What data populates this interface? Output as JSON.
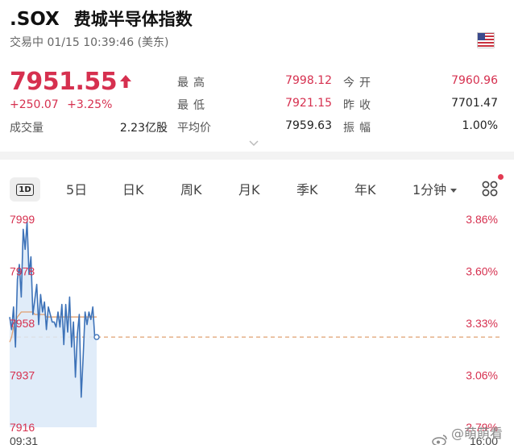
{
  "header": {
    "ticker": ".SOX",
    "name": "费城半导体指数",
    "status": "交易中 01/15 10:39:46 (美东)",
    "flag_icon": "us-flag-icon"
  },
  "quote": {
    "price": "7951.55",
    "direction": "up",
    "change": "+250.07",
    "change_pct": "+3.25%",
    "volume_label": "成交量",
    "volume_value": "2.23亿股",
    "up_color": "#d6304f"
  },
  "stats": {
    "high_label": "最高",
    "high_value": "7998.12",
    "low_label": "最低",
    "low_value": "7921.15",
    "avg_label": "平均价",
    "avg_value": "7959.63",
    "open_label": "今开",
    "open_value": "7960.96",
    "prev_close_label": "昨收",
    "prev_close_value": "7701.47",
    "amplitude_label": "振幅",
    "amplitude_value": "1.00%"
  },
  "tabs": {
    "active": "1D",
    "items": [
      "5日",
      "日K",
      "周K",
      "月K",
      "季K",
      "年K"
    ],
    "interval": "1分钟"
  },
  "chart_data": {
    "type": "line",
    "y_ticks": [
      "7999",
      "7978",
      "7958",
      "7937",
      "7916"
    ],
    "pct_ticks": [
      "3.86%",
      "3.60%",
      "3.33%",
      "3.06%",
      "2.79%"
    ],
    "ylim": [
      7916,
      7999
    ],
    "prev_close_ref": "7952",
    "x_start": "09:31",
    "x_end": "16:00",
    "price_color": "#3d72b8",
    "avg_color": "#e0a070",
    "fill_color": "#dbe9f8",
    "series": [
      {
        "values": [
          7960,
          7955,
          7964,
          7948,
          7975,
          7981,
          7968,
          7995,
          7987,
          7998,
          7977,
          7984,
          7961,
          7967,
          7973,
          7957,
          7969,
          7962,
          7966,
          7955,
          7964,
          7961,
          7958,
          7958,
          7956,
          7962,
          7956,
          7965,
          7949,
          7965,
          7954,
          7968,
          7948,
          7958,
          7936,
          7953,
          7961,
          7928,
          7944,
          7962,
          7957,
          7962,
          7959,
          7964,
          7952,
          7952
        ]
      },
      {
        "values": [
          7950,
          7952,
          7956,
          7958,
          7960,
          7961,
          7962,
          7962,
          7962,
          7962,
          7962,
          7962,
          7962,
          7961,
          7961,
          7961,
          7961,
          7961,
          7961,
          7960,
          7960,
          7960,
          7960,
          7960,
          7960,
          7960,
          7960,
          7960,
          7960,
          7960,
          7960,
          7960,
          7960,
          7960,
          7960,
          7960,
          7960,
          7960,
          7960,
          7960,
          7960,
          7960,
          7960,
          7960,
          7960,
          7960
        ]
      }
    ]
  },
  "watermark": {
    "text": "@萌萌看盘"
  }
}
